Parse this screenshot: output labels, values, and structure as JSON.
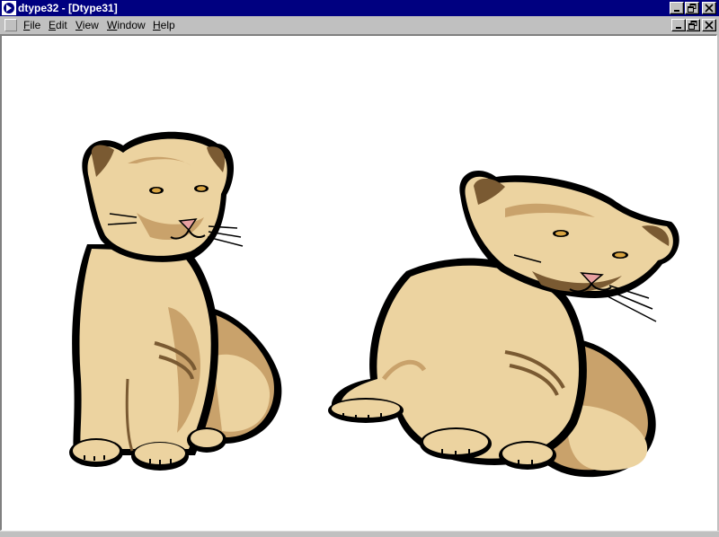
{
  "window": {
    "title": "dtype32 - [Dtype31]",
    "controls": [
      "minimize-icon",
      "restore-icon",
      "close-icon"
    ]
  },
  "menu": {
    "items": [
      {
        "label": "File",
        "accel": "F",
        "rest": "ile"
      },
      {
        "label": "Edit",
        "accel": "E",
        "rest": "dit"
      },
      {
        "label": "View",
        "accel": "V",
        "rest": "iew"
      },
      {
        "label": "Window",
        "accel": "W",
        "rest": "indow"
      },
      {
        "label": "Help",
        "accel": "H",
        "rest": "elp"
      }
    ]
  },
  "document": {
    "content": "clip-art illustration of two lion cubs",
    "colors": {
      "fur": "#ecd3a0",
      "fur_dark": "#c9a26b",
      "stripe": "#7a5a32",
      "outline": "#000000",
      "nose": "#e8a0a0"
    }
  },
  "colors": {
    "titlebar": "#000080",
    "face": "#c0c0c0",
    "canvas": "#ffffff"
  }
}
